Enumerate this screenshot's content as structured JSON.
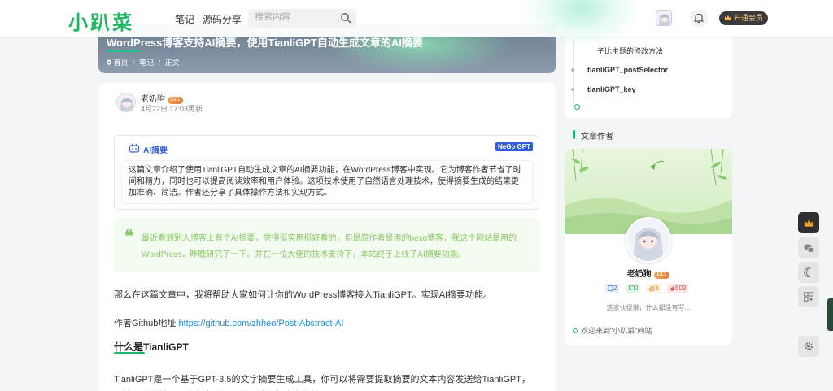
{
  "header": {
    "logo": "小趴菜",
    "nav": [
      "笔记",
      "源码分享"
    ],
    "search_placeholder": "搜索内容",
    "vip_label": "开通会员"
  },
  "banner": {
    "title": "WordPress博客支持AI摘要，使用TianliGPT自动生成文章的AI摘要",
    "breadcrumbs": [
      "首页",
      "笔记",
      "正文"
    ],
    "crumb_sep": "/"
  },
  "article": {
    "author": "老奶狗",
    "level": "LV.1",
    "date": "4月22日 17:03更新",
    "ai_box": {
      "title": "AI摘要",
      "badge": "NeGo GPT",
      "text": "这篇文章介绍了使用TianliGPT自动生成文章的AI摘要功能，在WordPress博客中实现。它为博客作者节省了时间和精力，同时也可以提高阅读效率和用户体验。这项技术使用了自然语言处理技术，使得摘要生成的结果更加准确、简洁。作者还分享了具体操作方法和实现方式。"
    },
    "quote_mark": "❝",
    "quote": "最近看到别人博客上有个AI摘要，觉得挺实用挺好看的，但是原作者是用的hexo博客，我这个网站是用的WordPress，昨晚研究了一下。并在一位大佬的技术支持下，本站终于上线了AI摘要功能。",
    "para1": "那么在这篇文章中，我将帮助大家如何让你的WordPress博客接入TianliGPT。实现AI摘要功能。",
    "github_label": "作者Github地址 ",
    "github_url": "https://github.com/zhheo/Post-Abstract-AI",
    "section_title": "什么是TianliGPT",
    "para2": "TianliGPT是一个基于GPT-3.5的文字摘要生成工具，你可以将需要提取摘要的文本内容发送给TianliGPT，稍等一会他就可以给你发送一个基于该段落内容的摘要。"
  },
  "toc": {
    "items": [
      {
        "label": "子比主题的修改方法",
        "bold": false
      },
      {
        "label": "tianliGPT_postSelector",
        "bold": true
      },
      {
        "label": "tianliGPT_key",
        "bold": true
      }
    ]
  },
  "sidebar": {
    "section_title": "文章作者",
    "author_name": "老奶狗",
    "level": "LV.1",
    "stats": {
      "posts": "2",
      "comments": "0",
      "likes": "3",
      "views": "502"
    },
    "desc": "这家伙很懒，什么都没有写...",
    "welcome": "欢迎来到\"小趴菜\"网站"
  },
  "colors": {
    "brand": "#1fb863",
    "accent": "#22b36b",
    "link": "#1e8bd8",
    "quote_text": "#8bc767",
    "ai_title": "#3a62d8"
  },
  "icons": [
    "search-icon",
    "bell-icon",
    "crown-icon",
    "robot-icon",
    "location-pin-icon",
    "wechat-icon",
    "moon-icon",
    "qrcode-icon",
    "gear-icon"
  ]
}
